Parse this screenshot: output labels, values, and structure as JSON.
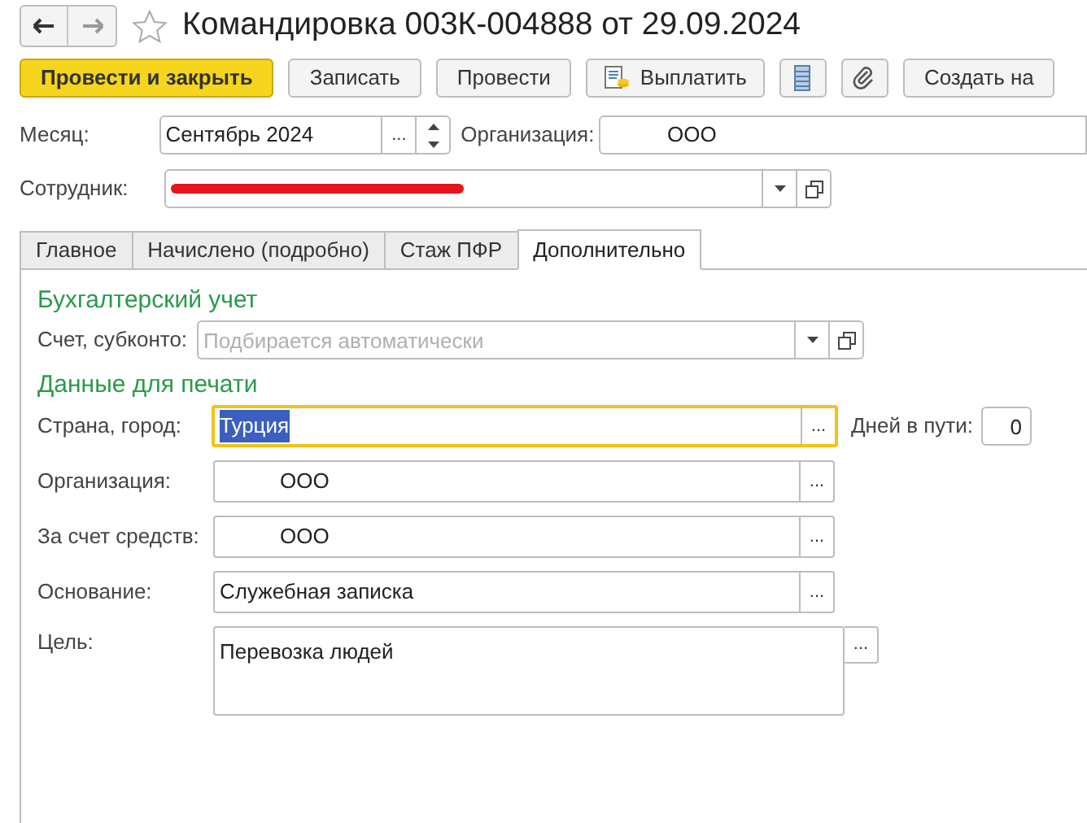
{
  "nav_buttons": [
    {
      "kind": "back",
      "disabled": false
    },
    {
      "kind": "forward",
      "disabled": true
    }
  ],
  "favorite": {
    "starred": false
  },
  "title": "Командировка 003К-004888 от 29.09.2024",
  "toolbar": [
    {
      "kind": "primary",
      "label": "Провести и закрыть"
    },
    {
      "kind": "text",
      "label": "Записать"
    },
    {
      "kind": "text",
      "label": "Провести"
    },
    {
      "kind": "payout",
      "label": "Выплатить"
    },
    {
      "kind": "list"
    },
    {
      "kind": "attach"
    },
    {
      "kind": "text",
      "label": "Создать на"
    }
  ],
  "month": {
    "label": "Месяц:",
    "value": "Сентябрь 2024",
    "button": "..."
  },
  "organization": {
    "label": "Организация:",
    "value": "ООО"
  },
  "employee": {
    "label": "Сотрудник:",
    "redacted": true
  },
  "tabs": [
    {
      "label": "Главное",
      "selected": false
    },
    {
      "label": "Начислено (подробно)",
      "selected": false
    },
    {
      "label": "Стаж ПФР",
      "selected": false
    },
    {
      "label": "Дополнительно",
      "selected": true
    }
  ],
  "sections": [
    {
      "title": "Бухгалтерский учет",
      "fields": [
        {
          "kind": "select",
          "label": "Счет, субконто:",
          "placeholder": "Подбирается автоматически"
        }
      ]
    },
    {
      "title": "Данные для печати",
      "fields": [
        {
          "kind": "choice",
          "label": "Страна, город:",
          "value": "Турция",
          "button": "...",
          "focused": true,
          "extra_label": "Дней в пути:",
          "extra_value": "0"
        },
        {
          "kind": "choice",
          "label": "Организация:",
          "value": "ООО",
          "button": "...",
          "focused": false
        },
        {
          "kind": "choice",
          "label": "За счет средств:",
          "value": "ООО",
          "button": "...",
          "focused": false
        },
        {
          "kind": "choice",
          "label": "Основание:",
          "value": "Служебная записка",
          "button": "...",
          "focused": false
        },
        {
          "kind": "textarea",
          "label": "Цель:",
          "value": "Перевозка людей",
          "button": "..."
        }
      ]
    }
  ]
}
